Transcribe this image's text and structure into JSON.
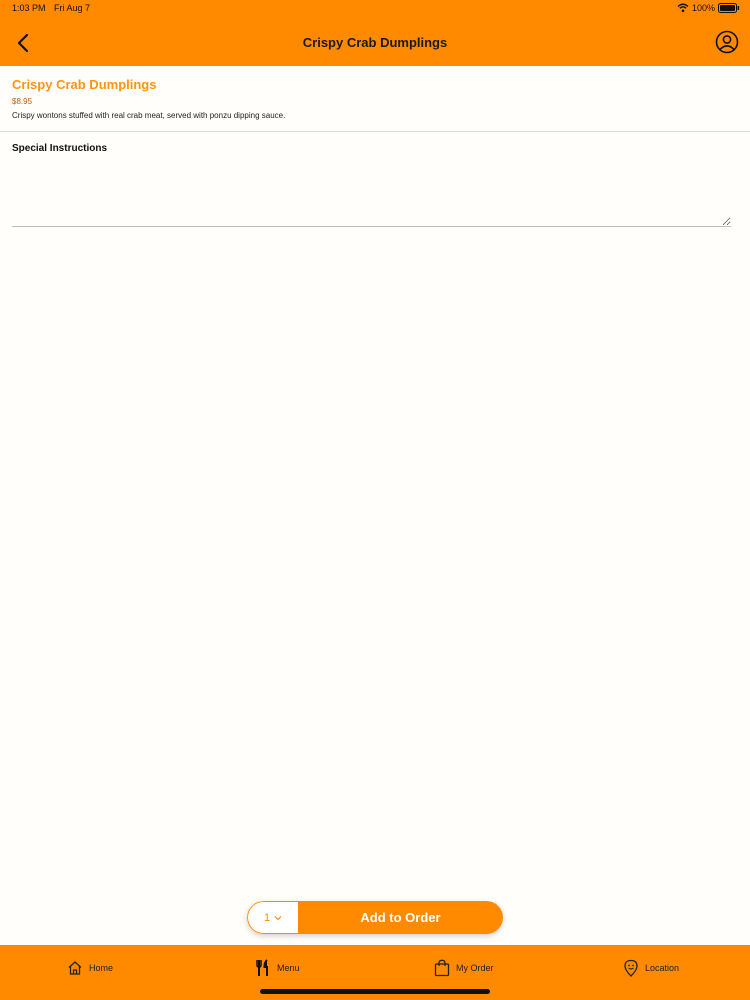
{
  "status_bar": {
    "time": "1:03 PM",
    "date": "Fri Aug 7",
    "battery": "100%"
  },
  "header": {
    "title": "Crispy Crab Dumplings",
    "back_icon": "chevron-left-icon",
    "profile_icon": "user-circle-icon"
  },
  "item": {
    "name": "Crispy Crab Dumplings",
    "price": "$8.95",
    "description": "Crispy wontons stuffed with real crab meat, served with ponzu dipping sauce."
  },
  "instructions": {
    "label": "Special Instructions",
    "value": ""
  },
  "order": {
    "quantity": "1",
    "add_label": "Add to Order"
  },
  "tabs": [
    {
      "label": "Home",
      "icon": "home-icon"
    },
    {
      "label": "Menu",
      "icon": "fork-knife-icon"
    },
    {
      "label": "My Order",
      "icon": "shopping-bag-icon"
    },
    {
      "label": "Location",
      "icon": "location-pin-icon"
    }
  ],
  "colors": {
    "brand": "#ff8a00",
    "item_title": "#ff9410",
    "price": "#c0600a"
  }
}
